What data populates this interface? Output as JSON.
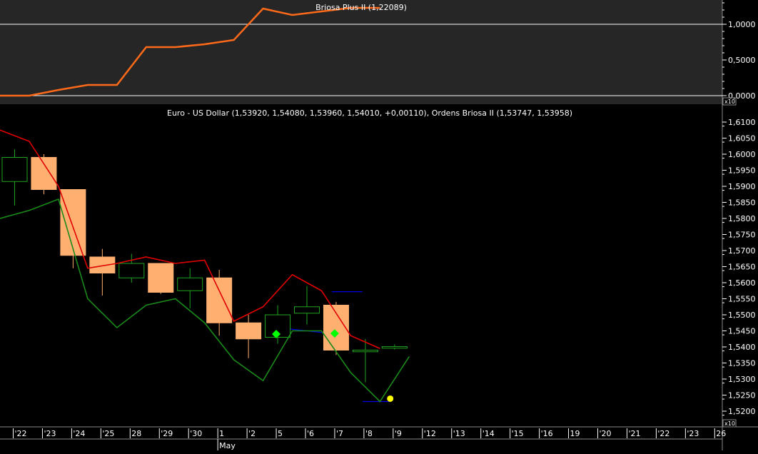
{
  "chart_data": [
    {
      "type": "line",
      "title": "Briosa Plus II (1,22089)",
      "colors": {
        "line": "#FF6A1A",
        "refline": "#FFFFFF",
        "background": "#262626"
      },
      "ylim": [
        -0.02,
        1.3
      ],
      "y_ticks": [
        {
          "value": 1.0,
          "label": "1,0000"
        },
        {
          "value": 0.5,
          "label": "0,5000"
        },
        {
          "value": 0.0,
          "label": "0,0000"
        }
      ],
      "ref_lines": [
        1.0,
        0.0
      ],
      "x_index": [
        -0.5,
        0.5,
        1.5,
        2.5,
        3.5,
        4.5,
        5.5,
        6.5,
        7.5,
        8.5,
        9.5,
        10.5,
        11.5,
        12.5
      ],
      "values": [
        0.0,
        0.0,
        0.08,
        0.15,
        0.15,
        0.68,
        0.68,
        0.72,
        0.78,
        1.22,
        1.13,
        1.18,
        1.23,
        1.23
      ]
    },
    {
      "type": "candlestick",
      "title": "Euro - US Dollar (1,53920, 1,54080, 1,53960, 1,54010, +0,00110), Ordens Briosa II (1,53747, 1,53958)",
      "scale_label": "x10",
      "ylim": [
        1.5172,
        1.6136
      ],
      "y_ticks": [
        {
          "value": 1.61,
          "label": "1,6100"
        },
        {
          "value": 1.605,
          "label": "1,6050"
        },
        {
          "value": 1.6,
          "label": "1,6000"
        },
        {
          "value": 1.595,
          "label": "1,5950"
        },
        {
          "value": 1.59,
          "label": "1,5900"
        },
        {
          "value": 1.585,
          "label": "1,5850"
        },
        {
          "value": 1.58,
          "label": "1,5800"
        },
        {
          "value": 1.575,
          "label": "1,5750"
        },
        {
          "value": 1.57,
          "label": "1,5700"
        },
        {
          "value": 1.565,
          "label": "1,5650"
        },
        {
          "value": 1.56,
          "label": "1,5600"
        },
        {
          "value": 1.555,
          "label": "1,5550"
        },
        {
          "value": 1.55,
          "label": "1,5500"
        },
        {
          "value": 1.545,
          "label": "1,5450"
        },
        {
          "value": 1.54,
          "label": "1,5400"
        },
        {
          "value": 1.535,
          "label": "1,5350"
        },
        {
          "value": 1.53,
          "label": "1,5300"
        },
        {
          "value": 1.525,
          "label": "1,5250"
        },
        {
          "value": 1.52,
          "label": "1,5200"
        }
      ],
      "x_labels": [
        "'22",
        "'23",
        "'24",
        "'25",
        "28",
        "'29",
        "'30",
        "1",
        "'2",
        "5",
        "'6",
        "'7",
        "'8",
        "'9",
        "'12",
        "'13",
        "'14",
        "'15",
        "'16",
        "19",
        "'20",
        "'21",
        "'22",
        "'23",
        "26"
      ],
      "month_labels": [
        {
          "index": 7,
          "label": "May"
        }
      ],
      "candles": [
        {
          "o": 1.5915,
          "h": 1.6015,
          "l": 1.584,
          "c": 1.599
        },
        {
          "o": 1.599,
          "h": 1.6,
          "l": 1.5875,
          "c": 1.589
        },
        {
          "o": 1.589,
          "h": 1.589,
          "l": 1.5645,
          "c": 1.5685
        },
        {
          "o": 1.568,
          "h": 1.5705,
          "l": 1.556,
          "c": 1.563
        },
        {
          "o": 1.5615,
          "h": 1.569,
          "l": 1.56,
          "c": 1.566
        },
        {
          "o": 1.566,
          "h": 1.566,
          "l": 1.5565,
          "c": 1.557
        },
        {
          "o": 1.5575,
          "h": 1.5645,
          "l": 1.552,
          "c": 1.5615
        },
        {
          "o": 1.5615,
          "h": 1.564,
          "l": 1.5435,
          "c": 1.5475
        },
        {
          "o": 1.5475,
          "h": 1.55,
          "l": 1.5365,
          "c": 1.5425
        },
        {
          "o": 1.543,
          "h": 1.553,
          "l": 1.541,
          "c": 1.55
        },
        {
          "o": 1.5505,
          "h": 1.559,
          "l": 1.547,
          "c": 1.5525
        },
        {
          "o": 1.553,
          "h": 1.554,
          "l": 1.5375,
          "c": 1.539
        },
        {
          "o": 1.5385,
          "h": 1.5425,
          "l": 1.529,
          "c": 1.539
        },
        {
          "o": 1.5396,
          "h": 1.5408,
          "l": 1.5392,
          "c": 1.5401
        }
      ],
      "candle_colors": {
        "up_outline": "#1FA31F",
        "down_fill": "#FFB070",
        "down_outline": "#FFB070",
        "wick_up": "#1FA31F",
        "wick_down": "#FFB070"
      },
      "bands": [
        {
          "color": "#E00000",
          "values": [
            1.6075,
            1.604,
            1.59,
            1.5645,
            1.566,
            1.568,
            1.566,
            1.567,
            1.548,
            1.5525,
            1.5625,
            1.5575,
            1.5435,
            1.5395
          ]
        },
        {
          "color": "#1A8A1A",
          "values": [
            1.58,
            1.5825,
            1.586,
            1.555,
            1.546,
            1.553,
            1.555,
            1.5475,
            1.536,
            1.5295,
            1.545,
            1.545,
            1.532,
            1.523,
            1.537
          ]
        }
      ],
      "band_x_index": [
        -0.5,
        0.5,
        1.5,
        2.5,
        3.5,
        4.5,
        5.5,
        6.5,
        7.5,
        8.5,
        9.5,
        10.5,
        11.5,
        12.5,
        13.5
      ],
      "order_lines": [
        {
          "color": "#0000E0",
          "x1": 9.0,
          "x2": 11.0,
          "y1": 1.546,
          "y2": 1.544
        },
        {
          "color": "#0000E0",
          "x1": 10.85,
          "x2": 11.9,
          "y1": 1.5572,
          "y2": 1.5572
        },
        {
          "color": "#0000E0",
          "x1": 11.9,
          "x2": 12.85,
          "y1": 1.523,
          "y2": 1.523
        }
      ],
      "markers": [
        {
          "shape": "diamond",
          "color": "#00FF00",
          "x": 8.95,
          "y": 1.544
        },
        {
          "shape": "diamond",
          "color": "#00FF00",
          "x": 10.95,
          "y": 1.5442
        },
        {
          "shape": "circle",
          "color": "#FFFF00",
          "x": 12.85,
          "y": 1.5239
        }
      ]
    }
  ]
}
